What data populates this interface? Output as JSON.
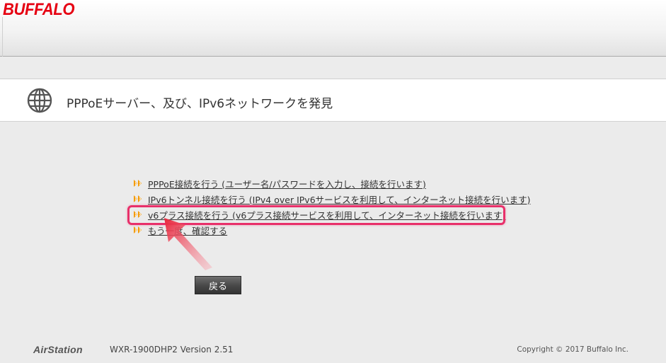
{
  "header": {
    "logo_text": "BUFFALO",
    "logo_color": "#e60012"
  },
  "title_bar": {
    "icon": "globe-icon",
    "title": "PPPoEサーバー、及び、IPv6ネットワークを発見"
  },
  "links": [
    {
      "label": "PPPoE接続を行う (ユーザー名/パスワードを入力し、接続を行います)",
      "icon": "double-arrow-icon"
    },
    {
      "label": "IPv6トンネル接続を行う (IPv4 over IPv6サービスを利用して、インターネット接続を行います)",
      "icon": "double-arrow-icon"
    },
    {
      "label": "v6プラス接続を行う (v6プラス接続サービスを利用して、インターネット接続を行います)",
      "icon": "double-arrow-icon",
      "highlighted": true
    },
    {
      "label": "もう一度、確認する",
      "icon": "double-arrow-icon"
    }
  ],
  "back_button": {
    "label": "戻る"
  },
  "footer": {
    "brand": "AirStation",
    "model": "WXR-1900DHP2  Version 2.51",
    "copyright": "Copyright © 2017 Buffalo Inc."
  },
  "colors": {
    "highlight": "#e8306a",
    "annotation_arrow": "#e8243a",
    "link_arrow": "#f39800"
  }
}
